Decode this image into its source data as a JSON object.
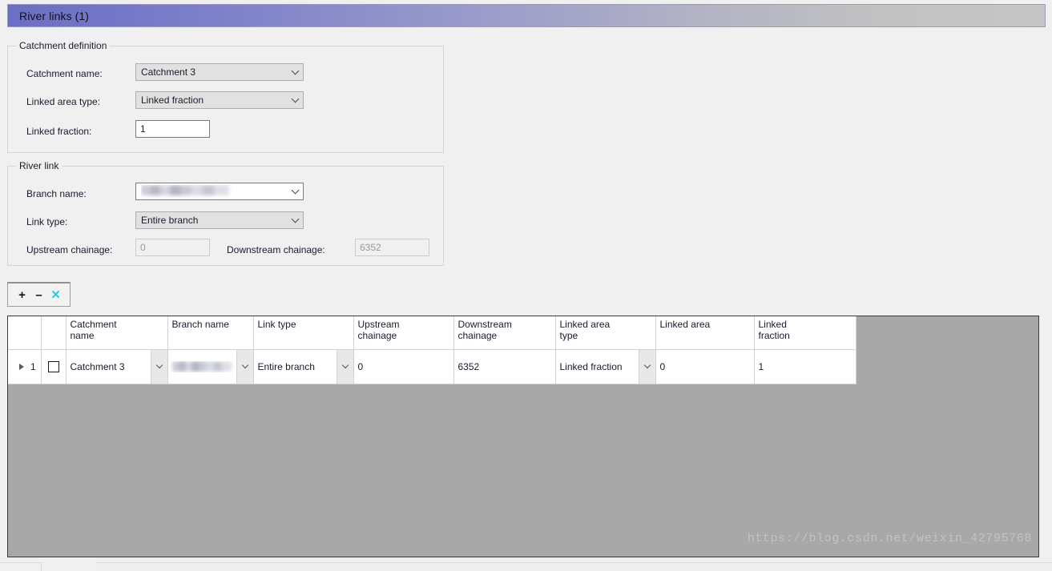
{
  "window": {
    "title": "River links (1)"
  },
  "catchment_definition": {
    "legend": "Catchment definition",
    "fields": {
      "catchment_name_label": "Catchment name:",
      "catchment_name_value": "Catchment 3",
      "linked_area_type_label": "Linked area type:",
      "linked_area_type_value": "Linked fraction",
      "linked_fraction_label": "Linked fraction:",
      "linked_fraction_value": "1"
    }
  },
  "river_link": {
    "legend": "River link",
    "fields": {
      "branch_name_label": "Branch name:",
      "branch_name_value": "",
      "link_type_label": "Link type:",
      "link_type_value": "Entire branch",
      "upstream_chainage_label": "Upstream chainage:",
      "upstream_chainage_value": "0",
      "downstream_chainage_label": "Downstream chainage:",
      "downstream_chainage_value": "6352"
    }
  },
  "toolbar": {
    "add_label": "+",
    "remove_label": "–",
    "delete_label": "✕"
  },
  "grid": {
    "columns": [
      {
        "key": "rowmark",
        "label": ""
      },
      {
        "key": "check",
        "label": ""
      },
      {
        "key": "catchment_name",
        "label": "Catchment\nname"
      },
      {
        "key": "branch_name",
        "label": "Branch name"
      },
      {
        "key": "link_type",
        "label": "Link type"
      },
      {
        "key": "upstream_chainage",
        "label": "Upstream\nchainage"
      },
      {
        "key": "downstream_chainage",
        "label": "Downstream\nchainage"
      },
      {
        "key": "linked_area_type",
        "label": "Linked area\ntype"
      },
      {
        "key": "linked_area",
        "label": "Linked area"
      },
      {
        "key": "linked_fraction",
        "label": "Linked\nfraction"
      }
    ],
    "rows": [
      {
        "row_number": "1",
        "selected": true,
        "checked": false,
        "catchment_name": "Catchment 3",
        "branch_name": "",
        "link_type": "Entire branch",
        "upstream_chainage": "0",
        "downstream_chainage": "6352",
        "linked_area_type": "Linked fraction",
        "linked_area": "0",
        "linked_fraction": "1"
      }
    ]
  },
  "watermark": {
    "text": "https://blog.csdn.net/weixin_42795768"
  },
  "colors": {
    "title_gradient_start": "#6b6ec4",
    "title_gradient_end": "#c6c6c6",
    "grid_background": "#a8a8a8",
    "selection_blue": "#1675d1",
    "delete_icon": "#1ad1e0"
  }
}
